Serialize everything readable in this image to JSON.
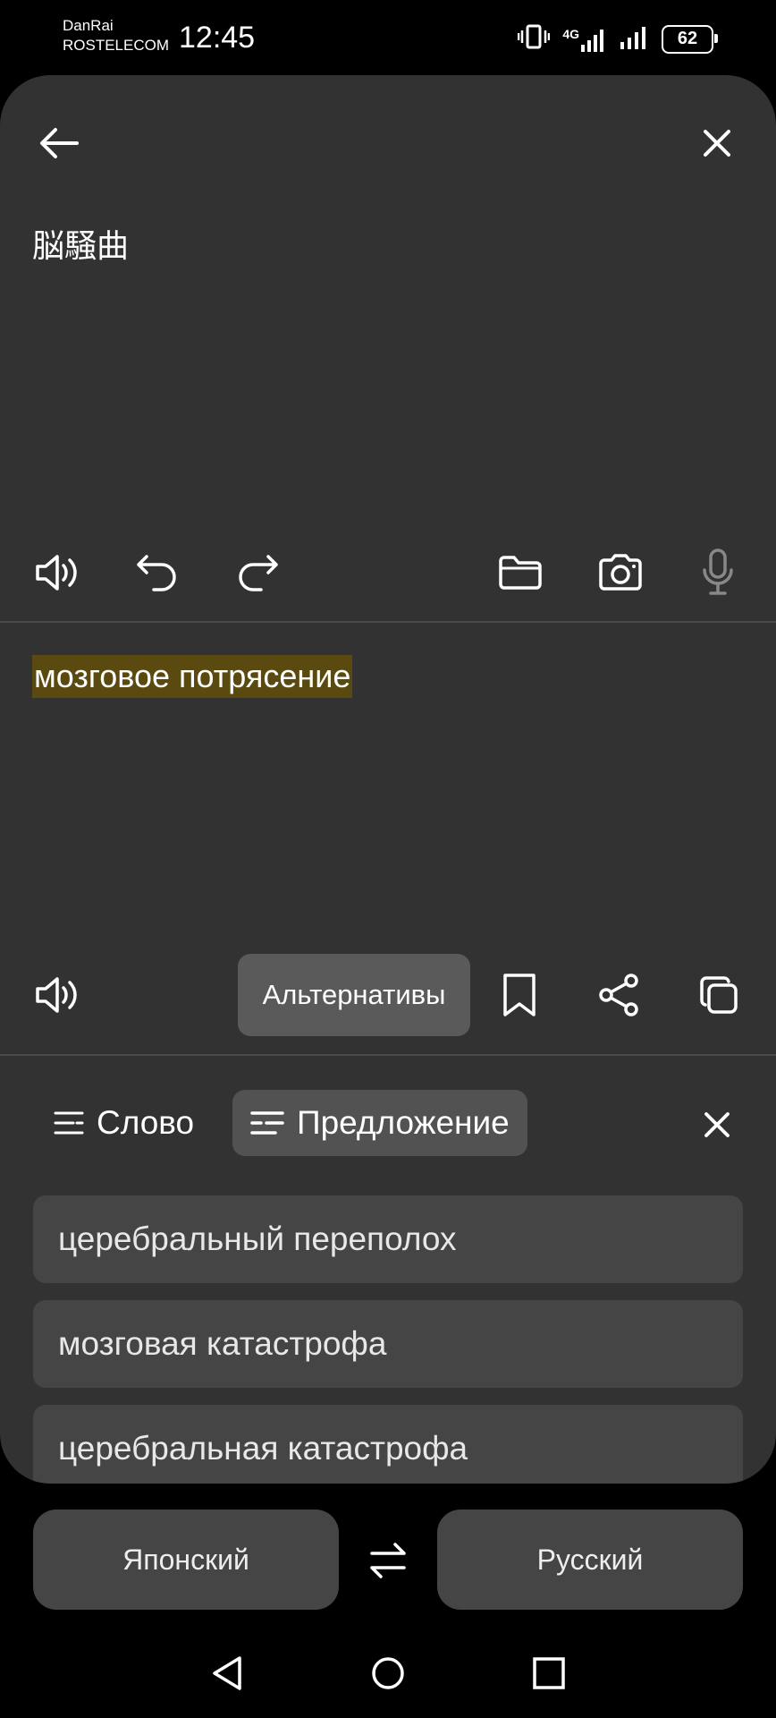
{
  "status_bar": {
    "carrier_line1": "DanRai",
    "carrier_line2": "ROSTELECOM",
    "time": "12:45",
    "network": "4G",
    "battery": "62"
  },
  "source": {
    "text": "脳騒曲"
  },
  "translation": {
    "text": "мозговое потрясение",
    "highlight_color": "#5a4a10"
  },
  "toolbar": {
    "alternatives_label": "Альтернативы"
  },
  "alternatives_panel": {
    "tabs": [
      {
        "label": "Слово"
      },
      {
        "label": "Предложение"
      }
    ],
    "items": [
      "церебральный переполох",
      "мозговая катастрофа",
      "церебральная катастрофа"
    ]
  },
  "languages": {
    "source": "Японский",
    "target": "Русский"
  },
  "colors": {
    "card_bg": "#323232",
    "item_bg": "#454545",
    "active_tab_bg": "#525252"
  }
}
